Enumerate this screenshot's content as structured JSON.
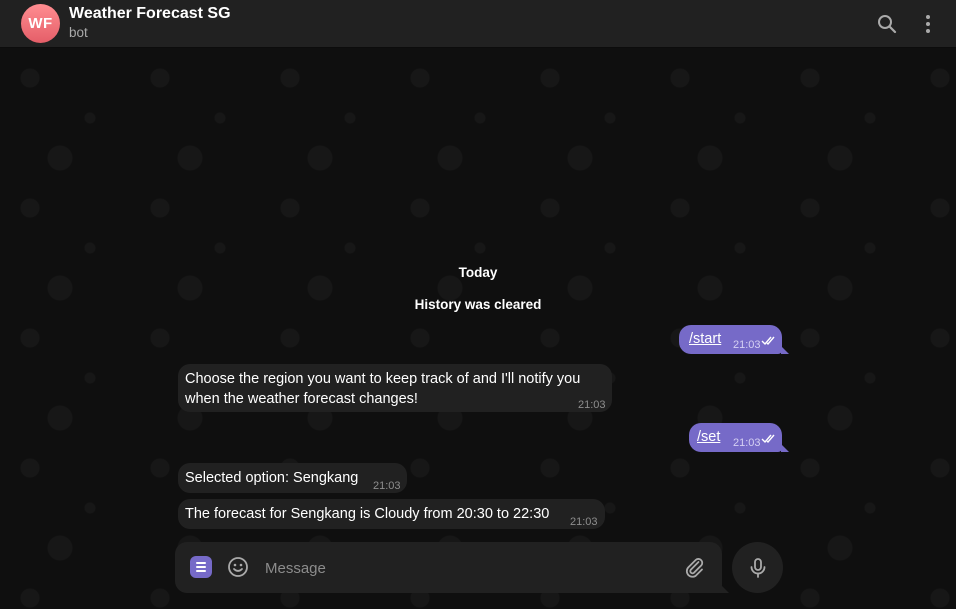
{
  "header": {
    "avatar_initials": "WF",
    "title": "Weather Forecast SG",
    "subtitle": "bot"
  },
  "chat": {
    "date_label": "Today",
    "service_message": "History was cleared",
    "messages": [
      {
        "direction": "outgoing",
        "text": "/start",
        "time": "21:03",
        "status": "read"
      },
      {
        "direction": "incoming",
        "text_line1": "Choose the region you want to keep track of and I'll notify you",
        "text_line2": "when the weather forecast changes!",
        "time": "21:03"
      },
      {
        "direction": "outgoing",
        "text": "/set",
        "time": "21:03",
        "status": "read"
      },
      {
        "direction": "incoming",
        "text": "Selected option: Sengkang",
        "time": "21:03"
      },
      {
        "direction": "incoming",
        "text": "The forecast for Sengkang is Cloudy from 20:30 to 22:30",
        "time": "21:03"
      }
    ]
  },
  "composer": {
    "placeholder": "Message"
  },
  "icons": {
    "search": "search-icon",
    "more": "more-vertical-icon",
    "menu": "bot-menu-icon",
    "emoji": "smile-icon",
    "attach": "paperclip-icon",
    "mic": "microphone-icon",
    "read": "double-check-icon"
  },
  "colors": {
    "header_bg": "#212121",
    "chat_bg": "#0f0f0f",
    "incoming_bubble": "#212121",
    "outgoing_bubble": "#766ac8",
    "avatar_gradient": [
      "#ff8d91",
      "#e55e68"
    ]
  }
}
